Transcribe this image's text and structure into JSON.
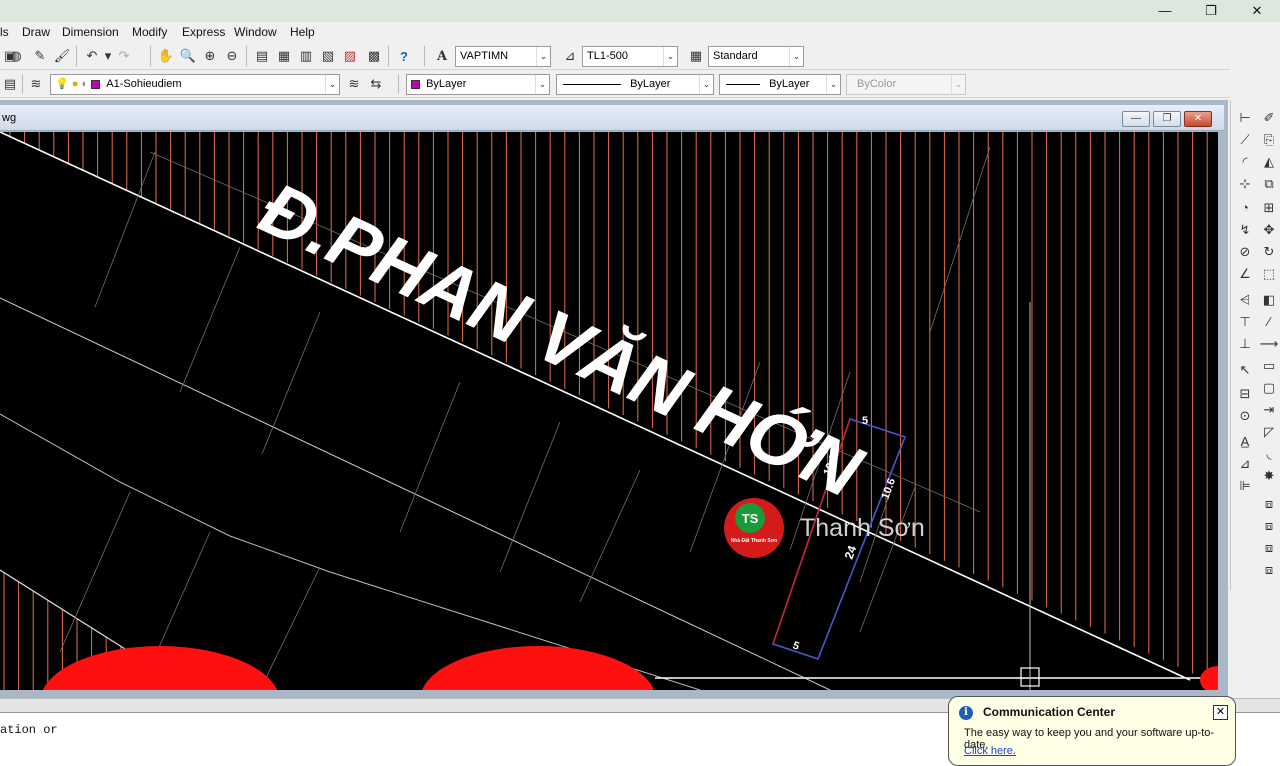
{
  "window": {
    "controls": {
      "minimize": "—",
      "maximize": "❐",
      "close": "✕"
    }
  },
  "menu": {
    "items": [
      "ls",
      "Draw",
      "Dimension",
      "Modify",
      "Express",
      "Window",
      "Help"
    ]
  },
  "toolbar1": {
    "text_style": "VAPTIMN",
    "dim_style": "TL1-500",
    "table_style": "Standard"
  },
  "toolbar2": {
    "layer": "A1-Sohieudiem",
    "color": "ByLayer",
    "linetype": "ByLayer",
    "lineweight": "ByLayer",
    "plotstyle": "ByColor",
    "colors": {
      "layer_swatch": "#c000c0",
      "color_swatch": "#c000c0"
    }
  },
  "document": {
    "title": "wg",
    "controls": {
      "minimize": "—",
      "restore": "❐",
      "close": "✕"
    }
  },
  "drawing": {
    "street_name": "Đ.PHAN VĂN HỚN",
    "dimensions": {
      "top": "5",
      "left": "10.1",
      "right": "10.6",
      "long": "24",
      "bottom": "5"
    },
    "watermark": {
      "badge": "TS",
      "brand": "Thanh Sơn",
      "badge_caption": "Nhà Đất Thanh Sơn"
    },
    "colors": {
      "background": "#000000",
      "hatch": "#e8704a",
      "boundary": "#ffffff",
      "lot_outline": "#4a58d0",
      "lot_side": "#d02020",
      "blob": "#ff1010"
    }
  },
  "command_line": {
    "text": "ation or"
  },
  "communication_center": {
    "title": "Communication Center",
    "message": "The easy way to keep you and your software up-to-date.",
    "link": "Click here.",
    "close": "✕",
    "info": "i"
  }
}
